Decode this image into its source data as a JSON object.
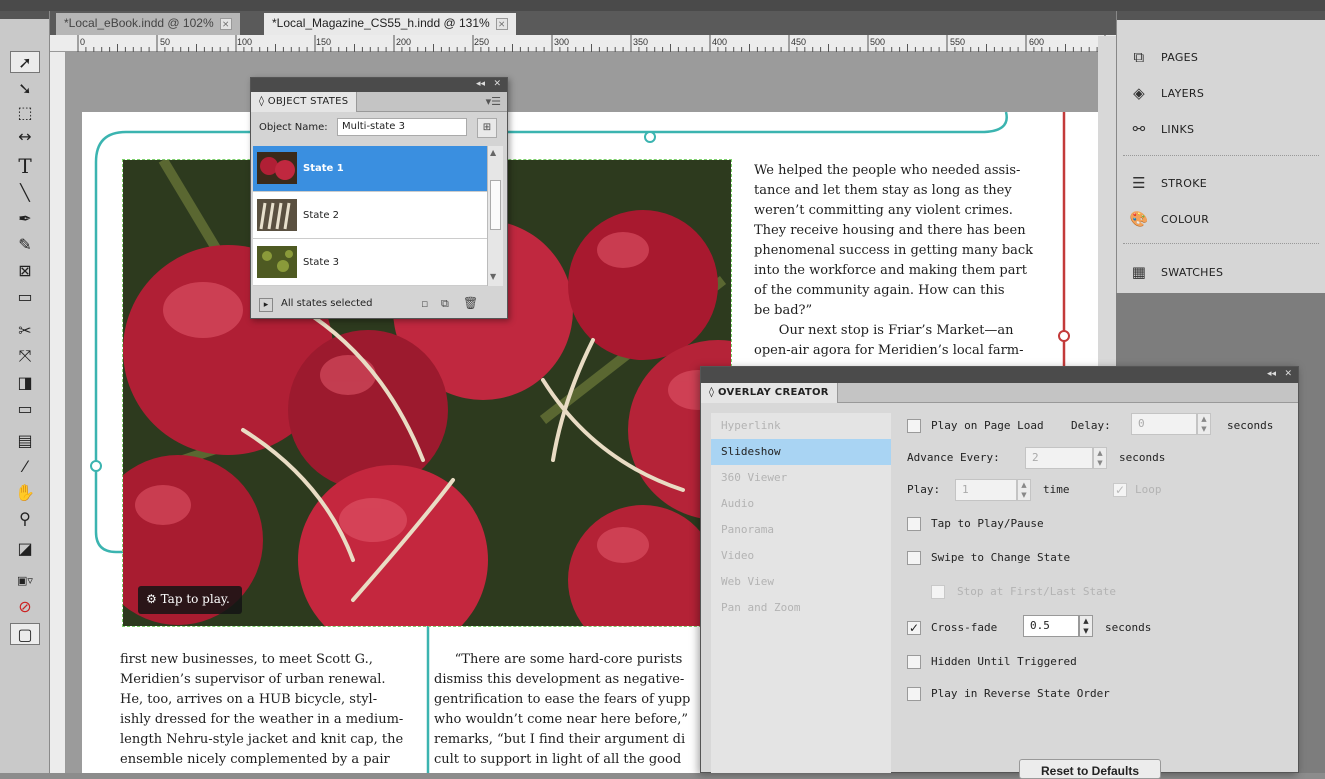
{
  "tabs": [
    {
      "label": "*Local_eBook.indd @ 102%",
      "close": "⨯"
    },
    {
      "label": "*Local_Magazine_CS55_h.indd @ 131%",
      "close": "⨯"
    }
  ],
  "ruler": {
    "ticks": [
      "0",
      "50",
      "100",
      "150",
      "200",
      "250",
      "300",
      "350",
      "400",
      "450",
      "500",
      "550",
      "600"
    ]
  },
  "tools": [
    "selection",
    "direct-selection",
    "page",
    "gap",
    "type",
    "line",
    "pen",
    "pencil",
    "rectangle-frame",
    "rectangle",
    "scissors",
    "free-transform",
    "gradient-swatch",
    "gradient-feather",
    "note",
    "eyedropper",
    "hand",
    "zoom",
    "fill-stroke",
    "formatting",
    "apply-none",
    "screen-mode"
  ],
  "right_panel": {
    "items": [
      {
        "label": "PAGES",
        "icon": "pages-icon"
      },
      {
        "label": "LAYERS",
        "icon": "layers-icon"
      },
      {
        "label": "LINKS",
        "icon": "links-icon"
      },
      {
        "label": "STROKE",
        "icon": "stroke-icon"
      },
      {
        "label": "COLOUR",
        "icon": "colour-icon"
      },
      {
        "label": "SWATCHES",
        "icon": "swatches-icon"
      }
    ]
  },
  "object_states": {
    "title": "◊ OBJECT STATES",
    "object_name_label": "Object Name:",
    "object_name_value": "Multi-state 3",
    "states": [
      "State 1",
      "State 2",
      "State 3"
    ],
    "selected_state": "State 1",
    "footer_text": "All states selected"
  },
  "photo": {
    "tap_label": "Tap to play."
  },
  "article": {
    "col_right": "We helped the people who needed assis-\ntance and let them stay as long as they\nweren’t committing any violent crimes.\nThey receive housing and there has been\nphenomenal success in getting many back\ninto the workforce and making them part\nof the community again. How can this\nbe bad?”\n      Our next stop is Friar’s Market—an\nopen-air agora for Meridien’s local farm-",
    "col_left": "first new businesses, to meet Scott G.,\nMeridien’s supervisor of urban renewal.\nHe, too, arrives on a HUB bicycle, styl-\nishly dressed for the weather in a medium-\nlength Nehru-style jacket and knit cap, the\nensemble nicely complemented by a pair",
    "col_mid": "     “There are some hard-core purists\ndismiss this development as negative-\ngentrification to ease the fears of yupp\nwho wouldn’t come near here before,” \nremarks, “but I find their argument di\ncult to support in light of all the good"
  },
  "overlay_creator": {
    "title": "◊ OVERLAY CREATOR",
    "nav": [
      "Hyperlink",
      "Slideshow",
      "360 Viewer",
      "Audio",
      "Panorama",
      "Video",
      "Web View",
      "Pan and Zoom"
    ],
    "selected_nav": "Slideshow",
    "options": {
      "play_on_page_load": "Play on Page Load",
      "delay_label": "Delay:",
      "delay_value": "0",
      "seconds": "seconds",
      "advance_every_label": "Advance Every:",
      "advance_every_value": "2",
      "play_label": "Play:",
      "play_value": "1",
      "time_label": "time",
      "loop_label": "Loop",
      "tap_to_play": "Tap to Play/Pause",
      "swipe": "Swipe to Change State",
      "stop_at": "Stop at First/Last State",
      "crossfade": "Cross-fade",
      "crossfade_value": "0.5",
      "hidden": "Hidden Until Triggered",
      "reverse": "Play in Reverse State Order",
      "reset": "Reset to Defaults"
    },
    "checked": {
      "crossfade": true,
      "loop": true
    }
  },
  "colors": {
    "accent_teal": "#3bb4b0",
    "red_line": "#c33a3a",
    "selection_blue": "#3a8fe0",
    "nav_highlight": "#a9d4f3"
  }
}
